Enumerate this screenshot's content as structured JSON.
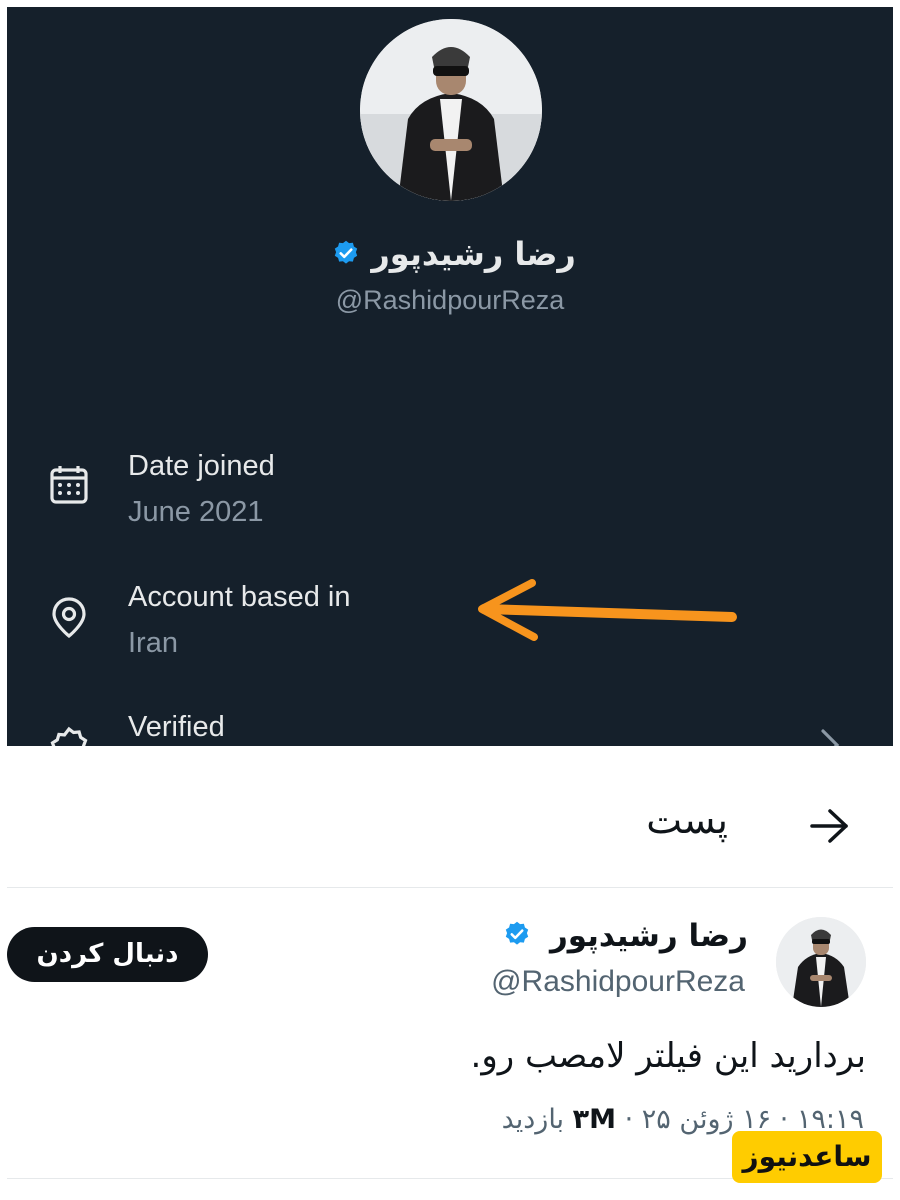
{
  "profile": {
    "display_name": "رضا رشیدپور",
    "handle": "@RashidpourReza",
    "date_joined_label": "Date joined",
    "date_joined_value": "June 2021",
    "location_label": "Account based in",
    "location_value": "Iran",
    "verified_label": "Verified"
  },
  "post": {
    "header_title": "پست",
    "author_name": "رضا رشیدپور",
    "author_handle": "@RashidpourReza",
    "follow_label": "دنبال کردن",
    "text": "بردارید این فیلتر لامصب رو.",
    "timestamp": "۱۹:۱۹ · ۱۶ ژوئن ۲۵ ·",
    "views_count": "۳M",
    "views_label": "بازدید"
  },
  "watermark": "ساعدنیوز",
  "colors": {
    "dark_bg": "#15202b",
    "verified_blue": "#1d9bf0",
    "annotation_orange": "#f7941d"
  },
  "icons": [
    "calendar-icon",
    "location-pin-icon",
    "verified-badge-icon",
    "arrow-icon",
    "chevron-right-icon"
  ]
}
